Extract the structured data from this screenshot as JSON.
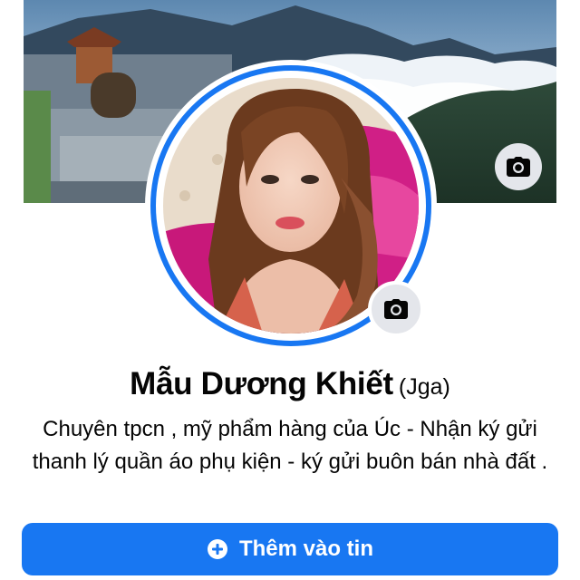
{
  "profile": {
    "name": "Mẫu Dương Khiết",
    "alternate_name": "(Jga)",
    "bio": "Chuyên tpcn , mỹ phẩm hàng của Úc - Nhận ký gửi thanh lý quần áo phụ kiện - ký gửi buôn bán nhà đất ."
  },
  "actions": {
    "add_story_label": "Thêm vào tin",
    "add_story_icon": "plus-circle-icon",
    "cover_camera_icon": "camera-icon",
    "avatar_camera_icon": "camera-icon"
  },
  "colors": {
    "accent": "#1877f2",
    "camera_button_bg": "#e4e6eb",
    "text": "#050505"
  }
}
